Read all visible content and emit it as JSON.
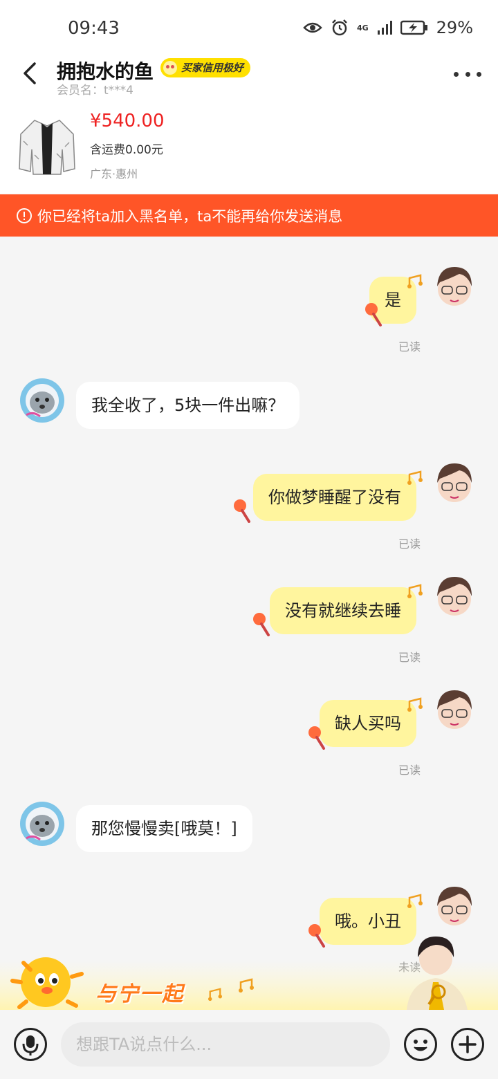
{
  "status_bar": {
    "time": "09:43",
    "network": "4G",
    "battery": "29%"
  },
  "header": {
    "name": "拥抱水的鱼",
    "credit_badge": "买家信用极好",
    "member_id": "会员名：t***4"
  },
  "product": {
    "price": "¥540.00",
    "shipping": "含运费0.00元",
    "location": "广东·惠州"
  },
  "banner": {
    "text": "你已经将ta加入黑名单，ta不能再给你发送消息"
  },
  "messages": [
    {
      "from": "me",
      "text": "是",
      "status": "已读"
    },
    {
      "from": "other",
      "text": "我全收了，5块一件出嘛？"
    },
    {
      "from": "me",
      "text": "你做梦睡醒了没有",
      "status": "已读"
    },
    {
      "from": "me",
      "text": "没有就继续去睡",
      "status": "已读"
    },
    {
      "from": "me",
      "text": "缺人买吗",
      "status": "已读"
    },
    {
      "from": "other",
      "text": "那您慢慢卖[哦莫！]"
    },
    {
      "from": "me",
      "text": "哦。小丑",
      "status": "未读"
    }
  ],
  "promo": {
    "text": "与宁一起"
  },
  "input": {
    "placeholder": "想跟TA说点什么..."
  },
  "colors": {
    "banner_bg": "#ff5527",
    "bubble_out": "#fff59e",
    "price": "#ee2222",
    "badge": "#ffe000"
  }
}
